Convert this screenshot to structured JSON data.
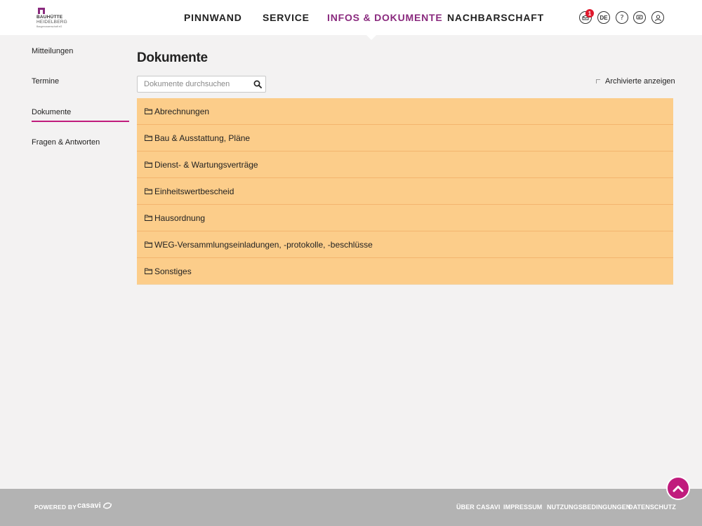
{
  "logo": {
    "line1": "BAUHÜTTE",
    "line2": "HEIDELBERG",
    "line3": "Baugenossenschaft eG"
  },
  "nav": {
    "items": [
      {
        "label": "PINNWAND",
        "active": false
      },
      {
        "label": "SERVICE",
        "active": false
      },
      {
        "label": "INFOS & DOKUMENTE",
        "active": true
      },
      {
        "label": "NACHBARSCHAFT",
        "active": false
      }
    ]
  },
  "header_icons": {
    "notifications_badge": "1",
    "language": "DE",
    "help_glyph": "?",
    "icon_names": [
      "notification-icon",
      "language-icon",
      "help-icon",
      "chat-icon",
      "user-icon"
    ]
  },
  "sidebar": {
    "items": [
      {
        "label": "Mitteilungen",
        "active": false
      },
      {
        "label": "Termine",
        "active": false
      },
      {
        "label": "Dokumente",
        "active": true
      },
      {
        "label": "Fragen & Antworten",
        "active": false
      }
    ]
  },
  "main": {
    "title": "Dokumente",
    "search": {
      "placeholder": "Dokumente durchsuchen",
      "value": ""
    },
    "archived_label": "Archivierte anzeigen",
    "folders": [
      "Abrechnungen",
      "Bau & Ausstattung, Pläne",
      "Dienst- & Wartungsverträge",
      "Einheitswertbescheid",
      "Hausordnung",
      "WEG-Versammlungseinladungen, -protokolle, -beschlüsse",
      "Sonstiges"
    ]
  },
  "footer": {
    "powered_by": "POWERED BY",
    "brand": "casavi",
    "links": [
      "ÜBER CASAVI",
      "IMPRESSUM",
      "NUTZUNGSBEDINGUNGEN",
      "DATENSCHUTZ"
    ]
  },
  "colors": {
    "accent": "#8a2a7e",
    "active_underline": "#c01c7d",
    "folder_row": "#fccd8a",
    "badge": "#e0192d",
    "footer": "#b3b3b3",
    "background": "#f3f2f2"
  }
}
